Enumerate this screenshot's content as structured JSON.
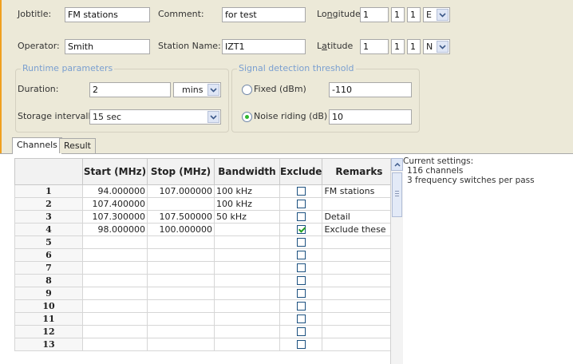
{
  "header": {
    "jobtitle_label": "Jobtitle:",
    "jobtitle_value": "FM stations",
    "comment_label": "Comment:",
    "comment_value": "for test",
    "operator_label": "Operator:",
    "operator_value": "Smith",
    "station_label": "Station Name:",
    "station_value": "IZT1",
    "longitude_label_pre": "Lo",
    "longitude_label_u": "n",
    "longitude_label_post": "gitude",
    "longitude_fields": [
      "1",
      "1",
      "1"
    ],
    "longitude_dir": "E",
    "latitude_label_pre": "L",
    "latitude_label_u": "a",
    "latitude_label_post": "titude",
    "latitude_fields": [
      "1",
      "1",
      "1"
    ],
    "latitude_dir": "N"
  },
  "runtime": {
    "title": "Runtime parameters",
    "duration_label": "Duration:",
    "duration_value": "2",
    "duration_unit": "mins",
    "storage_label": "Storage intervall:",
    "storage_value": "15 sec"
  },
  "threshold": {
    "title": "Signal detection threshold",
    "fixed_label": "Fixed (dBm)",
    "fixed_value": "-110",
    "fixed_selected": false,
    "noise_label": "Noise riding (dB)",
    "noise_value": "10",
    "noise_selected": true
  },
  "tabs": [
    {
      "label": "Channels",
      "active": true
    },
    {
      "label": "Result",
      "active": false
    }
  ],
  "table": {
    "headers": [
      "",
      "Start (MHz)",
      "Stop (MHz)",
      "Bandwidth",
      "Exclude",
      "Remarks"
    ],
    "rows": [
      {
        "n": "1",
        "start": "94.000000",
        "stop": "107.000000",
        "bw": "100 kHz",
        "exclude": false,
        "remarks": "FM stations"
      },
      {
        "n": "2",
        "start": "107.400000",
        "stop": "",
        "bw": "100 kHz",
        "exclude": false,
        "remarks": ""
      },
      {
        "n": "3",
        "start": "107.300000",
        "stop": "107.500000",
        "bw": "50 kHz",
        "exclude": false,
        "remarks": "Detail"
      },
      {
        "n": "4",
        "start": "98.000000",
        "stop": "100.000000",
        "bw": "",
        "exclude": true,
        "remarks": "Exclude these"
      },
      {
        "n": "5",
        "start": "",
        "stop": "",
        "bw": "",
        "exclude": false,
        "remarks": ""
      },
      {
        "n": "6",
        "start": "",
        "stop": "",
        "bw": "",
        "exclude": false,
        "remarks": ""
      },
      {
        "n": "7",
        "start": "",
        "stop": "",
        "bw": "",
        "exclude": false,
        "remarks": ""
      },
      {
        "n": "8",
        "start": "",
        "stop": "",
        "bw": "",
        "exclude": false,
        "remarks": ""
      },
      {
        "n": "9",
        "start": "",
        "stop": "",
        "bw": "",
        "exclude": false,
        "remarks": ""
      },
      {
        "n": "10",
        "start": "",
        "stop": "",
        "bw": "",
        "exclude": false,
        "remarks": ""
      },
      {
        "n": "11",
        "start": "",
        "stop": "",
        "bw": "",
        "exclude": false,
        "remarks": ""
      },
      {
        "n": "12",
        "start": "",
        "stop": "",
        "bw": "",
        "exclude": false,
        "remarks": ""
      },
      {
        "n": "13",
        "start": "",
        "stop": "",
        "bw": "",
        "exclude": false,
        "remarks": ""
      }
    ]
  },
  "settings": {
    "title": "Current settings:",
    "lines": [
      "116 channels",
      "3 frequency switches per pass"
    ]
  },
  "colors": {
    "accent_bar": "#f0a020",
    "group_title": "#7a9fd0",
    "checkmark": "#21a121"
  }
}
